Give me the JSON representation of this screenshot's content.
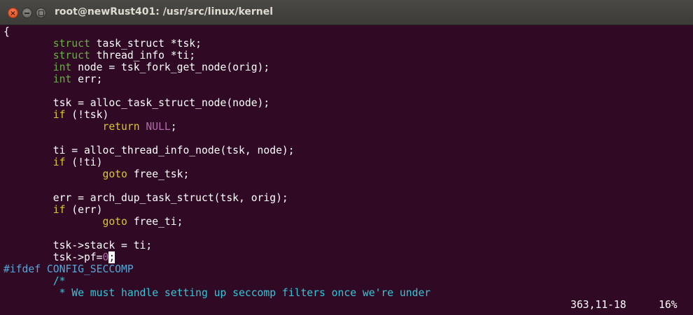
{
  "window": {
    "title": "root@newRust401: /usr/src/linux/kernel",
    "close_glyph": "×"
  },
  "code": {
    "l0": "{",
    "l1_indent": "        ",
    "l1_type": "struct",
    "l1_rest": " task_struct *tsk;",
    "l2_type": "struct",
    "l2_rest": " thread_info *ti;",
    "l3_type": "int",
    "l3_rest": " node = tsk_fork_get_node(orig);",
    "l4_type": "int",
    "l4_rest": " err;",
    "l6_text": "tsk = alloc_task_struct_node(node);",
    "l7_kw": "if",
    "l7_rest": " (!tsk)",
    "l8_kw": "return",
    "l8_null": "NULL",
    "l8_rest": ";",
    "l10_text": "ti = alloc_thread_info_node(tsk, node);",
    "l11_kw": "if",
    "l11_rest": " (!ti)",
    "l12_kw": "goto",
    "l12_rest": " free_tsk;",
    "l14_text": "err = arch_dup_task_struct(tsk, orig);",
    "l15_kw": "if",
    "l15_rest": " (err)",
    "l16_kw": "goto",
    "l16_rest": " free_ti;",
    "l18_text": "tsk->stack = ti;",
    "l19_text": "tsk->pf=",
    "l19_num": "0",
    "l19_cursor": ";",
    "l20_pre": "#ifdef CONFIG_SECCOMP",
    "l21_comment": "/*",
    "l22_comment": " * We must handle setting up seccomp filters once we're under"
  },
  "status": {
    "position": "363,11-18",
    "percent": "16%"
  },
  "colors": {
    "background": "#300a24",
    "type_keyword": "#67b045",
    "control_keyword": "#d8c82d",
    "constant": "#b06ca8",
    "preprocessor": "#55a7d8",
    "comment": "#34c6d6"
  }
}
